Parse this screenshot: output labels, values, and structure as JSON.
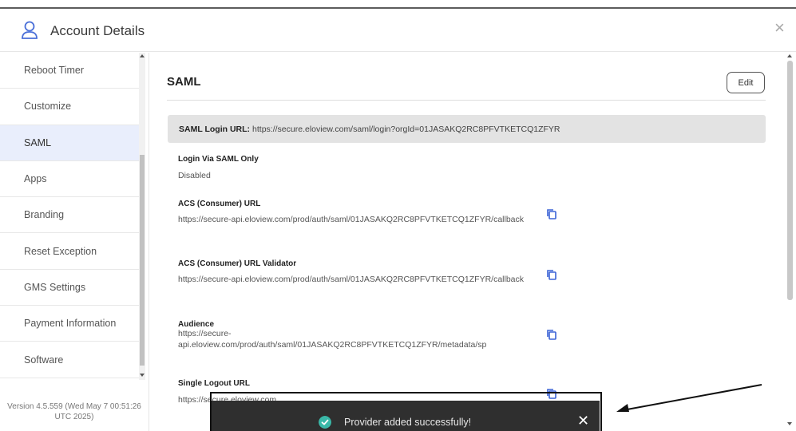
{
  "header": {
    "title": "Account Details",
    "close_symbol": "×",
    "user_icon": "user-icon"
  },
  "sidebar": {
    "items": [
      {
        "label": "Reboot Timer",
        "active": false
      },
      {
        "label": "Customize",
        "active": false
      },
      {
        "label": "SAML",
        "active": true
      },
      {
        "label": "Apps",
        "active": false
      },
      {
        "label": "Branding",
        "active": false
      },
      {
        "label": "Reset Exception",
        "active": false
      },
      {
        "label": "GMS Settings",
        "active": false
      },
      {
        "label": "Payment Information",
        "active": false
      },
      {
        "label": "Software",
        "active": false
      }
    ],
    "version_line1": "Version 4.5.559 (Wed May 7 00:51:26",
    "version_line2": "UTC 2025)"
  },
  "main": {
    "section_title": "SAML",
    "edit_label": "Edit",
    "login_url_label": "SAML Login URL:",
    "login_url_value": "https://secure.eloview.com/saml/login?orgId=01JASAKQ2RC8PFVTKETCQ1ZFYR",
    "fields": [
      {
        "label": "Login Via SAML Only",
        "value": "Disabled",
        "copy": false
      },
      {
        "label": "ACS (Consumer) URL",
        "value": "https://secure-api.eloview.com/prod/auth/saml/01JASAKQ2RC8PFVTKETCQ1ZFYR/callback",
        "copy": true
      },
      {
        "label": "ACS (Consumer) URL Validator",
        "value": "https://secure-api.eloview.com/prod/auth/saml/01JASAKQ2RC8PFVTKETCQ1ZFYR/callback",
        "copy": true
      },
      {
        "label": "Audience",
        "value_line1": "https://secure-",
        "value_line2": "api.eloview.com/prod/auth/saml/01JASAKQ2RC8PFVTKETCQ1ZFYR/metadata/sp",
        "copy": true
      },
      {
        "label": "Single Logout URL",
        "value": "https://secure.eloview.com",
        "copy": true
      }
    ]
  },
  "toast": {
    "message": "Provider added successfully!",
    "close_symbol": "✕",
    "icon": "check-circle-icon"
  },
  "colors": {
    "active_item_bg": "#e9eefc",
    "login_box_bg": "#e3e3e3",
    "toast_bg": "#2f2f2f",
    "toast_check": "#3ab8a8"
  }
}
